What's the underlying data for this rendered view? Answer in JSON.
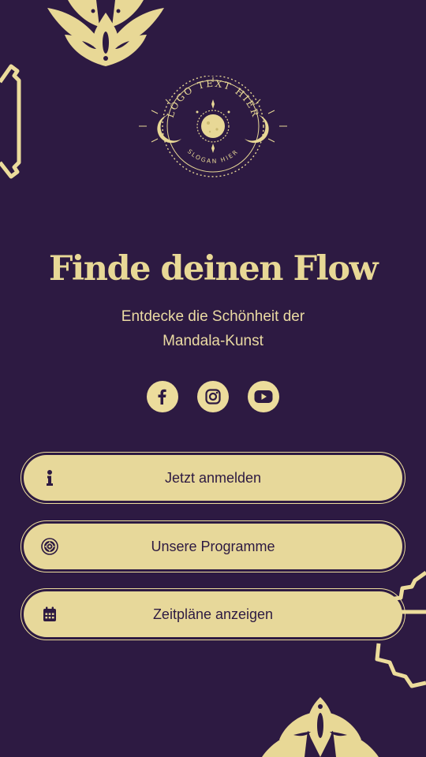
{
  "colors": {
    "background": "#2d1a42",
    "accent": "#e8d896",
    "button_text": "#2d1a42"
  },
  "logo": {
    "top_text": "LOGO TEXT HIER",
    "bottom_text": "SLOGAN HIER"
  },
  "hero": {
    "title": "Finde deinen Flow",
    "subtitle_line1": "Entdecke die Schönheit der",
    "subtitle_line2": "Mandala-Kunst"
  },
  "social": [
    {
      "icon": "facebook-icon"
    },
    {
      "icon": "instagram-icon"
    },
    {
      "icon": "youtube-icon"
    }
  ],
  "buttons": [
    {
      "label": "Jetzt anmelden",
      "icon": "info-icon"
    },
    {
      "label": "Unsere Programme",
      "icon": "mandala-icon"
    },
    {
      "label": "Zeitpläne anzeigen",
      "icon": "calendar-icon"
    }
  ]
}
